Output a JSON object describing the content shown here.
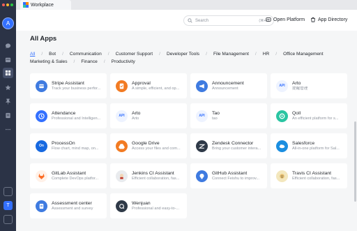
{
  "window": {
    "tab_title": "Workplace"
  },
  "user": {
    "avatar_initial": "A"
  },
  "rail": {
    "bottom_labels": [
      "",
      "T",
      ""
    ]
  },
  "topbar": {
    "search_placeholder": "Search",
    "search_shortcut": "(⌘+K)",
    "open_platform": "Open Platform",
    "app_directory": "App Directory"
  },
  "page": {
    "title": "All Apps"
  },
  "filters": [
    "All",
    "Bot",
    "Communication",
    "Customer Support",
    "Developer Tools",
    "File Management",
    "HR",
    "Office Management",
    "Marketing & Sales",
    "Finance",
    "Productivity"
  ],
  "apps": [
    {
      "name": "Stripe Assistant",
      "desc": "Track your business perfor...",
      "icon": "stripe-icon",
      "color": "#3f7be0"
    },
    {
      "name": "Approval",
      "desc": "A simple, efficient, and op...",
      "icon": "approval-icon",
      "color": "#f27b23"
    },
    {
      "name": "Announcement",
      "desc": "Announcement",
      "icon": "megaphone-icon",
      "color": "#3f7be0"
    },
    {
      "name": "Arto",
      "desc": "提醒管理",
      "icon": "api-icon",
      "color": "#eef3ff"
    },
    {
      "name": "Attendance",
      "desc": "Professional and Intelligen...",
      "icon": "clock-icon",
      "color": "#3370ff"
    },
    {
      "name": "Arto",
      "desc": "Arto",
      "icon": "api-icon",
      "color": "#eef3ff"
    },
    {
      "name": "Tao",
      "desc": "tao",
      "icon": "api-icon",
      "color": "#eef3ff"
    },
    {
      "name": "Qoll",
      "desc": "An efficient platform for s...",
      "icon": "qoll-icon",
      "color": "#2bc5a2"
    },
    {
      "name": "ProcessOn",
      "desc": "Flow chart, mind map, on...",
      "icon": "processon-icon",
      "color": "#1769e0"
    },
    {
      "name": "Google Drive",
      "desc": "Access your files and com...",
      "icon": "google-drive-icon",
      "color": "#f27b23"
    },
    {
      "name": "Zendesk Connector",
      "desc": "Bring your customer intera...",
      "icon": "zendesk-icon",
      "color": "#2f3a48"
    },
    {
      "name": "Salesforce",
      "desc": "All-in-one platform for Sal...",
      "icon": "salesforce-icon",
      "color": "#1b8ee0"
    },
    {
      "name": "GitLab Assistant",
      "desc": "Complete DevOps platfor...",
      "icon": "gitlab-icon",
      "color": "#fc6d26"
    },
    {
      "name": "Jenkins CI Assistant",
      "desc": "Efficient collaboration, fas...",
      "icon": "jenkins-icon",
      "color": "#d6d8dc"
    },
    {
      "name": "GitHub Assistant",
      "desc": "Connect Feishu to improv...",
      "icon": "github-icon",
      "color": "#3f7be0"
    },
    {
      "name": "Travis CI Assistant",
      "desc": "Efficient collaboration, fas...",
      "icon": "travis-icon",
      "color": "#e8d9a0"
    },
    {
      "name": "Assessment center",
      "desc": "Assessment and survey",
      "icon": "assessment-icon",
      "color": "#3f7be0"
    },
    {
      "name": "Wenjuan",
      "desc": "Professional and easy-to-...",
      "icon": "wenjuan-icon",
      "color": "#2f3a48"
    }
  ],
  "colors": {
    "accent": "#3370ff",
    "rail_bg": "#2b3346"
  }
}
